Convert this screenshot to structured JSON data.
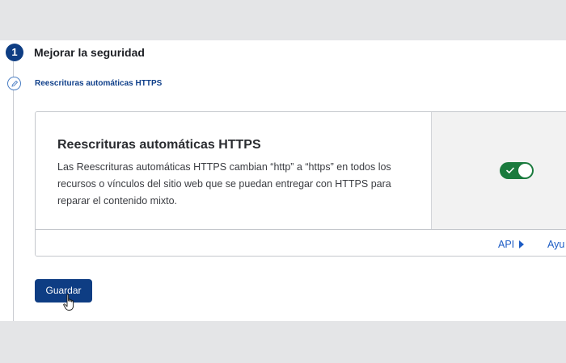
{
  "step": {
    "number": "1",
    "title": "Mejorar la seguridad"
  },
  "substep": {
    "icon": "pencil-icon",
    "title": "Reescrituras automáticas HTTPS"
  },
  "card": {
    "heading": "Reescrituras automáticas HTTPS",
    "description": "Las Reescrituras automáticas HTTPS cambian “http” a “https” en todos los recursos o vínculos del sitio web que se puedan entregar con HTTPS para reparar el contenido mixto.",
    "toggle_on": true,
    "footer_links": {
      "api": "API",
      "help": "Ayu"
    }
  },
  "actions": {
    "save_label": "Guardar"
  },
  "colors": {
    "primary": "#0e3d83",
    "toggle_on": "#1a7a3d",
    "link": "#1c5bc4"
  }
}
